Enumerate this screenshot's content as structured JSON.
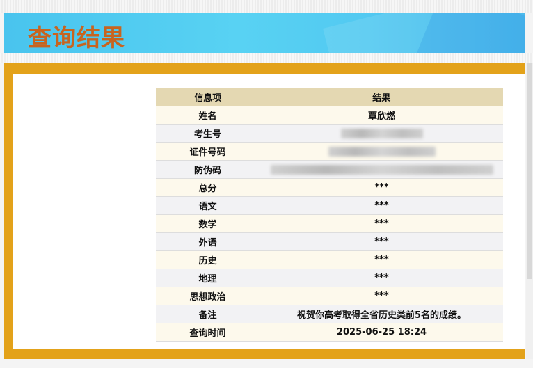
{
  "banner": {
    "title": "查询结果"
  },
  "table": {
    "headers": [
      "信息项",
      "结果"
    ],
    "rows": [
      {
        "label": "姓名",
        "value": "覃欣燃"
      },
      {
        "label": "考生号",
        "value": ""
      },
      {
        "label": "证件号码",
        "value": ""
      },
      {
        "label": "防伪码",
        "value": ""
      },
      {
        "label": "总分",
        "value": "***"
      },
      {
        "label": "语文",
        "value": "***"
      },
      {
        "label": "数学",
        "value": "***"
      },
      {
        "label": "外语",
        "value": "***"
      },
      {
        "label": "历史",
        "value": "***"
      },
      {
        "label": "地理",
        "value": "***"
      },
      {
        "label": "思想政治",
        "value": "***"
      },
      {
        "label": "备注",
        "value": "祝贺你高考取得全省历史类前5名的成绩。"
      },
      {
        "label": "查询时间",
        "value": "2025-06-25 18:24"
      }
    ]
  },
  "colors": {
    "banner_title": "#c8641f",
    "frame": "#e3a21a",
    "header_bg": "#e4d8b2",
    "banner_bg": "#4fc9f1"
  }
}
